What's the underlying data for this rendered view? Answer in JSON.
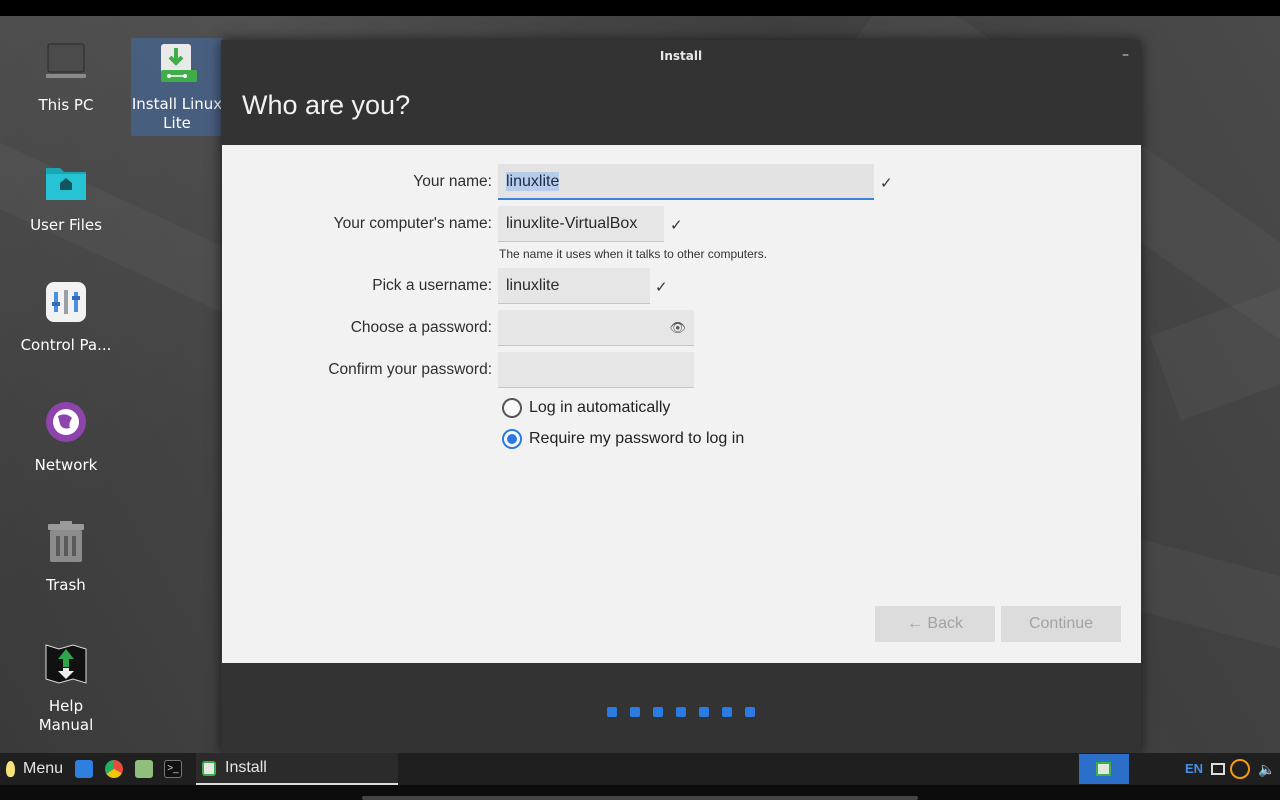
{
  "desktop": {
    "icons": [
      {
        "label": "This PC",
        "icon": "monitor-icon"
      },
      {
        "label": "Install Linux Lite",
        "icon": "installer-icon",
        "selected": true
      },
      {
        "label": "User Files",
        "icon": "home-folder-icon"
      },
      {
        "label": "Control Pa...",
        "icon": "control-panel-icon"
      },
      {
        "label": "Network",
        "icon": "globe-icon"
      },
      {
        "label": "Trash",
        "icon": "trash-icon"
      },
      {
        "label": "Help Manual",
        "icon": "help-manual-icon"
      }
    ]
  },
  "window": {
    "title": "Install",
    "minimize_glyph": "–",
    "heading": "Who are you?",
    "form": {
      "name_label": "Your name:",
      "name_value": "linuxlite",
      "computer_label": "Your computer's name:",
      "computer_value": "linuxlite-VirtualBox",
      "computer_hint": "The name it uses when it talks to other computers.",
      "username_label": "Pick a username:",
      "username_value": "linuxlite",
      "password_label": "Choose a password:",
      "password_value": "",
      "confirm_label": "Confirm your password:",
      "confirm_value": "",
      "check_glyph": "✓",
      "eye_glyph": "👁",
      "radio_auto": "Log in automatically",
      "radio_require": "Require my password to log in",
      "selected_radio": "require"
    },
    "buttons": {
      "back": "← Back",
      "continue": "Continue"
    },
    "progress_steps": 7
  },
  "taskbar": {
    "menu_label": "Menu",
    "task_label": "Install",
    "lang": "EN"
  },
  "colors": {
    "accent": "#2a7be4",
    "panel": "#f2f2f2",
    "window_bg": "#333333"
  }
}
